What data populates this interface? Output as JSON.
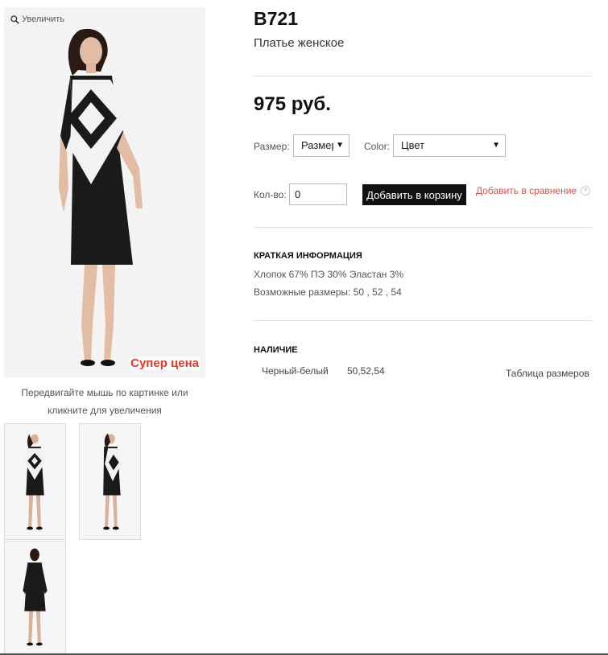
{
  "gallery": {
    "zoom_label": "Увеличить",
    "badge": "Супер цена",
    "hint": "Передвигайте мышь по картинке или кликните для увеличения"
  },
  "product": {
    "sku": "B721",
    "name": "Платье женское",
    "price": "975 руб."
  },
  "options": {
    "size_label": "Размер:",
    "size_value": "Размер",
    "color_label": "Color:",
    "color_value": "Цвет",
    "qty_label": "Кол-во:",
    "qty_value": "0",
    "add_to_cart": "Добавить в корзину",
    "add_to_compare": "Добавить в сравнение"
  },
  "short_info": {
    "title": "КРАТКАЯ ИНФОРМАЦИЯ",
    "composition": "Хлопок 67% ПЭ 30% Эластан 3%",
    "sizes": "Возможные размеры: 50 , 52 , 54"
  },
  "availability": {
    "title": "НАЛИЧИЕ",
    "color": "Черный-белый",
    "sizes": "50,52,54",
    "size_table": "Таблица размеров"
  },
  "colors": {
    "accent_red": "#e23b2e",
    "link_red": "#d9534f",
    "button_black": "#111111"
  }
}
